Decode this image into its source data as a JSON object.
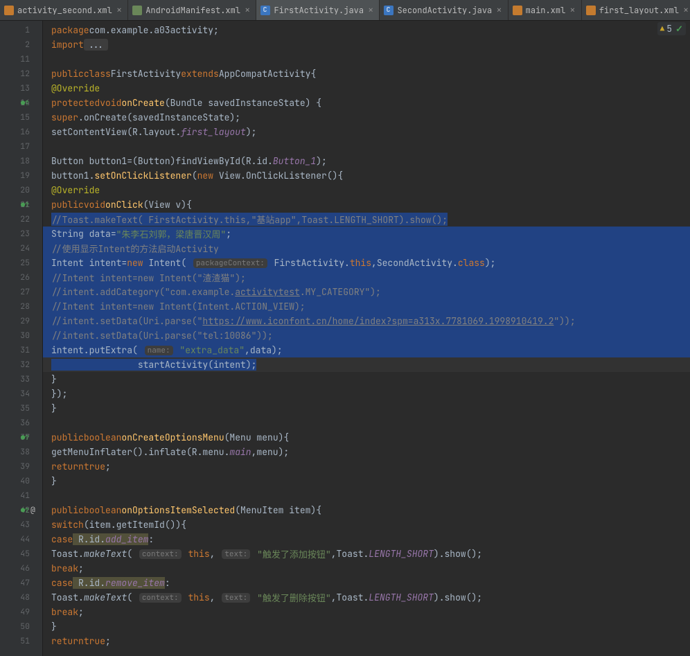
{
  "tabs": [
    {
      "name": "activity_second.xml",
      "kind": "xml",
      "active": false
    },
    {
      "name": "AndroidManifest.xml",
      "kind": "manifest",
      "active": false
    },
    {
      "name": "FirstActivity.java",
      "kind": "java",
      "active": true
    },
    {
      "name": "SecondActivity.java",
      "kind": "java",
      "active": false
    },
    {
      "name": "main.xml",
      "kind": "xml",
      "active": false
    },
    {
      "name": "first_layout.xml",
      "kind": "xml",
      "active": false
    }
  ],
  "warnings": {
    "count": "5"
  },
  "gutter": [
    {
      "n": "1"
    },
    {
      "n": "2"
    },
    {
      "n": "11"
    },
    {
      "n": "12"
    },
    {
      "n": "13"
    },
    {
      "n": "14",
      "ov": true
    },
    {
      "n": "15"
    },
    {
      "n": "16"
    },
    {
      "n": "17"
    },
    {
      "n": "18"
    },
    {
      "n": "19"
    },
    {
      "n": "20"
    },
    {
      "n": "21",
      "ov": true
    },
    {
      "n": "22"
    },
    {
      "n": "23"
    },
    {
      "n": "24"
    },
    {
      "n": "25"
    },
    {
      "n": "26"
    },
    {
      "n": "27"
    },
    {
      "n": "28"
    },
    {
      "n": "29"
    },
    {
      "n": "30"
    },
    {
      "n": "31"
    },
    {
      "n": "32",
      "bulb": true
    },
    {
      "n": "33"
    },
    {
      "n": "34"
    },
    {
      "n": "35"
    },
    {
      "n": "36"
    },
    {
      "n": "37",
      "ov": true
    },
    {
      "n": "38"
    },
    {
      "n": "39"
    },
    {
      "n": "40"
    },
    {
      "n": "41"
    },
    {
      "n": "42",
      "ov": true,
      "at": true
    },
    {
      "n": "43"
    },
    {
      "n": "44"
    },
    {
      "n": "45"
    },
    {
      "n": "46"
    },
    {
      "n": "47"
    },
    {
      "n": "48"
    },
    {
      "n": "49"
    },
    {
      "n": "50"
    },
    {
      "n": "51"
    }
  ],
  "code": {
    "l1": {
      "kw1": "package",
      "pkg": "com.example.a03activity",
      "sc": ";"
    },
    "l2": {
      "kw1": "import",
      "dots": "..."
    },
    "l12": {
      "kw1": "public",
      "kw2": "class",
      "cls": "FirstActivity",
      "kw3": "extends",
      "sup": "AppCompatActivity",
      "br": "{"
    },
    "l13": {
      "ann": "@Override"
    },
    "l14": {
      "kw1": "protected",
      "kw2": "void",
      "fn": "onCreate",
      "args": "(Bundle savedInstanceState) {"
    },
    "l15": {
      "kw1": "super",
      "call": ".onCreate(savedInstanceState);"
    },
    "l16": {
      "call1": "setContentView(R.layout.",
      "fld": "first_layout",
      "call2": ");"
    },
    "l18": {
      "t1": "Button button1=(",
      "cls": "Button",
      "t2": ")findViewById(R.id.",
      "fld": "Button_1",
      "t3": ");"
    },
    "l19": {
      "t1": "button1.",
      "fn": "setOnClickListener",
      "t2": "(",
      "kw1": "new",
      "t3": " View.OnClickListener(){"
    },
    "l20": {
      "ann": "@Override"
    },
    "l21": {
      "kw1": "public",
      "kw2": "void",
      "fn": "onClick",
      "args": "(View v){"
    },
    "l22": {
      "cmt": "//Toast.makeText( FirstActivity.this,\"基站app\",Toast.LENGTH_SHORT).show();"
    },
    "l23": {
      "t1": "String ",
      "fn": "data",
      "t2": "=",
      "str": "\"朱李石刘郭，梁唐晋汉周\"",
      "sc": ";"
    },
    "l24": {
      "cmt": "//使用显示Intent的方法启动Activity"
    },
    "l25": {
      "t1": "Intent intent=",
      "kw1": "new",
      "t2": " Intent( ",
      "hint": "packageContext:",
      "t3": " FirstActivity.",
      "kw2": "this",
      "t4": ",SecondActivity.",
      "kw3": "class",
      "t5": ");"
    },
    "l26": {
      "cmt": "//Intent intent=new Intent(\"渣渣猫\");"
    },
    "l27": {
      "cmt1": "//intent.addCategory(\"com.example.",
      "und": "activitytest",
      "cmt2": ".MY_CATEGORY\");"
    },
    "l28": {
      "cmt": "//Intent intent=new Intent(Intent.ACTION_VIEW);"
    },
    "l29": {
      "cmt1": "//intent.setData(Uri.parse(\"",
      "und": "https://www.iconfont.cn/home/index?spm=a313x.7781069.1998910419.2",
      "cmt2": "\"));"
    },
    "l30": {
      "cmt": "//intent.setData(Uri.parse(\"tel:10086\"));"
    },
    "l31": {
      "t1": "intent.putExtra( ",
      "hint": "name:",
      "t2": " ",
      "str": "\"extra_data\"",
      "t3": ",",
      "fn": "data",
      "t4": ");"
    },
    "l32": {
      "t1": "startActivity(intent);"
    },
    "l33": {
      "t": "}"
    },
    "l34": {
      "t": "});"
    },
    "l35": {
      "t": "}"
    },
    "l37": {
      "kw1": "public",
      "kw2": "boolean",
      "fn": "onCreateOptionsMenu",
      "args": "(Menu menu){"
    },
    "l38": {
      "t1": "getMenuInflater().inflate(R.menu.",
      "fld": "main",
      "t2": ",menu);"
    },
    "l39": {
      "kw1": "return",
      "kw2": "true",
      "sc": ";"
    },
    "l40": {
      "t": "}"
    },
    "l42": {
      "kw1": "public",
      "kw2": "boolean",
      "fn": "onOptionsItemSelected",
      "args": "(MenuItem item){"
    },
    "l43": {
      "kw1": "switch",
      "t1": "(item.getItemId()){"
    },
    "l44": {
      "kw1": "case",
      "t1": " R.id.",
      "fld": "add_item",
      "t2": ":"
    },
    "l45": {
      "t1": "Toast.",
      "fn": "makeText",
      "t2": "( ",
      "hint1": "context:",
      "t3": " ",
      "kw1": "this",
      "t4": ", ",
      "hint2": "text:",
      "t5": " ",
      "str": "\"触发了添加按钮\"",
      "t6": ",Toast.",
      "fld": "LENGTH_SHORT",
      "t7": ").show();"
    },
    "l46": {
      "kw1": "break",
      "sc": ";"
    },
    "l47": {
      "kw1": "case",
      "t1": " R.id.",
      "fld": "remove_item",
      "t2": ":"
    },
    "l48": {
      "t1": "Toast.",
      "fn": "makeText",
      "t2": "( ",
      "hint1": "context:",
      "t3": " ",
      "kw1": "this",
      "t4": ", ",
      "hint2": "text:",
      "t5": " ",
      "str": "\"触发了删除按钮\"",
      "t6": ",Toast.",
      "fld": "LENGTH_SHORT",
      "t7": ").show();"
    },
    "l49": {
      "kw1": "break",
      "sc": ";"
    },
    "l50": {
      "t": "}"
    },
    "l51": {
      "kw1": "return",
      "kw2": "true",
      "sc": ";"
    }
  }
}
